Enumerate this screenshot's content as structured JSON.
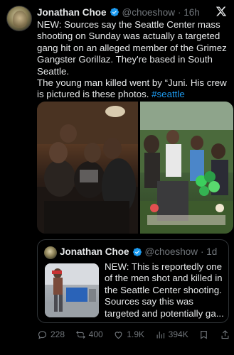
{
  "tweet": {
    "author_name": "Jonathan Choe",
    "handle": "@choeshow",
    "time": "· 16h",
    "text_lines": [
      "NEW: Sources say the Seattle Center mass shooting on Sunday was actually a targeted gang hit on an alleged member of the Grimez Gangster Gorillaz. They're based in South Seattle.",
      "The young man killed went by “Juni. His crew is pictured is these photos."
    ],
    "hashtag": "#seattle"
  },
  "quoted_tweet": {
    "author_name": "Jonathan Choe",
    "handle": "@choeshow",
    "time": "· 1d",
    "text": "NEW: This is reportedly one of the men shot and killed in the Seattle Center shooting. Sources say this was targeted and potentially ga..."
  },
  "actions": {
    "replies": "228",
    "reposts": "400",
    "likes": "1.9K",
    "views": "394K"
  },
  "colors": {
    "background": "#000000",
    "text": "#e7e9ea",
    "muted": "#71767b",
    "accent": "#1d9bf0",
    "border": "#2f3336"
  },
  "icons": [
    "verified-badge-icon",
    "x-logo-icon",
    "reply-icon",
    "repost-icon",
    "like-icon",
    "views-icon",
    "bookmark-icon",
    "share-icon"
  ]
}
